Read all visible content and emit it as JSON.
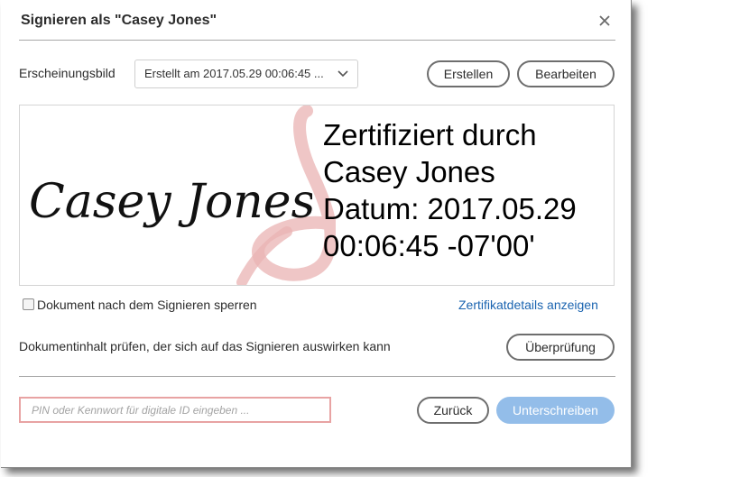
{
  "dialog": {
    "title": "Signieren als \"Casey Jones\"",
    "close_icon": "close-icon"
  },
  "appearance": {
    "label": "Erscheinungsbild",
    "selected": "Erstellt am 2017.05.29 00:06:45 ...",
    "create_label": "Erstellen",
    "edit_label": "Bearbeiten"
  },
  "signature_preview": {
    "handwritten_name": "Casey Jones",
    "lines": [
      "Zertifiziert durch",
      "Casey Jones",
      "Datum: 2017.05.29",
      "00:06:45 -07'00'"
    ],
    "watermark_icon": "acrobat-logo-icon"
  },
  "lock": {
    "label": "Dokument nach dem Signieren sperren",
    "checked": false
  },
  "cert_link": "Zertifikatdetails anzeigen",
  "review": {
    "text": "Dokumentinhalt prüfen, der sich auf das Signieren auswirken kann",
    "button": "Überprüfung"
  },
  "pin": {
    "placeholder": "PIN oder Kennwort für digitale ID eingeben ...",
    "value": ""
  },
  "footer": {
    "back_label": "Zurück",
    "sign_label": "Unterschreiben"
  },
  "colors": {
    "link": "#1b64b0",
    "primary_button": "#93bde9",
    "pin_border": "#e8a3a3",
    "watermark": "#e9b3b3"
  }
}
